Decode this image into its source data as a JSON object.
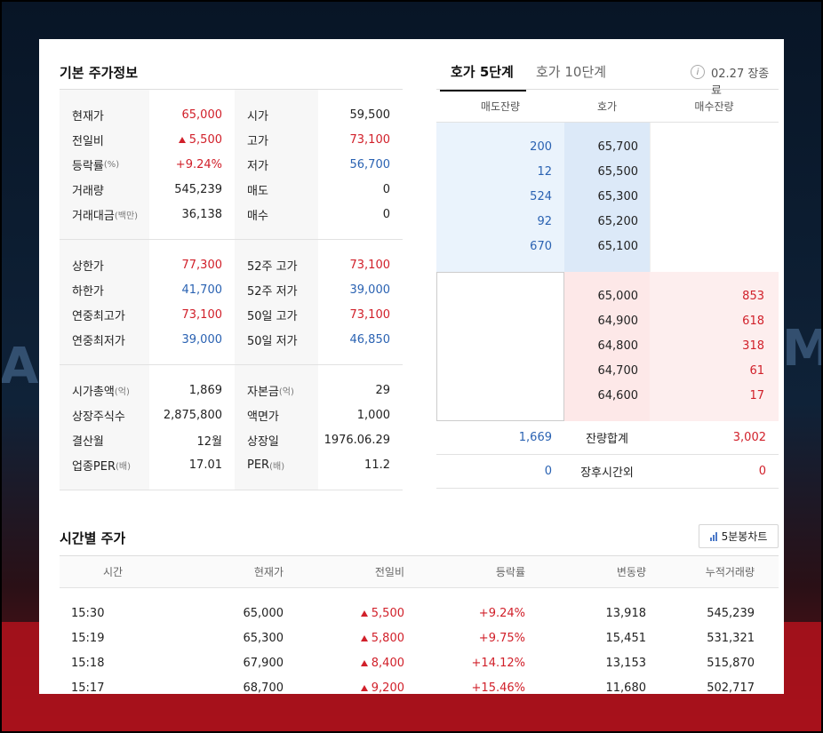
{
  "basic": {
    "title": "기본 주가정보",
    "groups": [
      {
        "rows": [
          {
            "label": "현재가",
            "label_small": "",
            "value": "65,000",
            "value_color": "red",
            "value_up": false,
            "label2": "시가",
            "label2_small": "",
            "value2": "59,500",
            "value2_color": ""
          },
          {
            "label": "전일비",
            "label_small": "",
            "value": "5,500",
            "value_color": "red",
            "value_up": true,
            "label2": "고가",
            "label2_small": "",
            "value2": "73,100",
            "value2_color": "red"
          },
          {
            "label": "등락률",
            "label_small": "(%)",
            "value": "+9.24%",
            "value_color": "red",
            "value_up": false,
            "label2": "저가",
            "label2_small": "",
            "value2": "56,700",
            "value2_color": "blue"
          },
          {
            "label": "거래량",
            "label_small": "",
            "value": "545,239",
            "value_color": "",
            "value_up": false,
            "label2": "매도",
            "label2_small": "",
            "value2": "0",
            "value2_color": ""
          },
          {
            "label": "거래대금",
            "label_small": "(백만)",
            "value": "36,138",
            "value_color": "",
            "value_up": false,
            "label2": "매수",
            "label2_small": "",
            "value2": "0",
            "value2_color": ""
          }
        ]
      },
      {
        "rows": [
          {
            "label": "상한가",
            "label_small": "",
            "value": "77,300",
            "value_color": "red",
            "value_up": false,
            "label2": "52주 고가",
            "label2_small": "",
            "value2": "73,100",
            "value2_color": "red"
          },
          {
            "label": "하한가",
            "label_small": "",
            "value": "41,700",
            "value_color": "blue",
            "value_up": false,
            "label2": "52주 저가",
            "label2_small": "",
            "value2": "39,000",
            "value2_color": "blue"
          },
          {
            "label": "연중최고가",
            "label_small": "",
            "value": "73,100",
            "value_color": "red",
            "value_up": false,
            "label2": "50일 고가",
            "label2_small": "",
            "value2": "73,100",
            "value2_color": "red"
          },
          {
            "label": "연중최저가",
            "label_small": "",
            "value": "39,000",
            "value_color": "blue",
            "value_up": false,
            "label2": "50일 저가",
            "label2_small": "",
            "value2": "46,850",
            "value2_color": "blue"
          }
        ]
      },
      {
        "rows": [
          {
            "label": "시가총액",
            "label_small": "(억)",
            "value": "1,869",
            "value_color": "",
            "value_up": false,
            "label2": "자본금",
            "label2_small": "(억)",
            "value2": "29",
            "value2_color": ""
          },
          {
            "label": "상장주식수",
            "label_small": "",
            "value": "2,875,800",
            "value_color": "",
            "value_up": false,
            "label2": "액면가",
            "label2_small": "",
            "value2": "1,000",
            "value2_color": ""
          },
          {
            "label": "결산월",
            "label_small": "",
            "value": "12월",
            "value_color": "",
            "value_up": false,
            "label2": "상장일",
            "label2_small": "",
            "value2": "1976.06.29",
            "value2_color": ""
          },
          {
            "label": "업종PER",
            "label_small": "(배)",
            "value": "17.01",
            "value_color": "",
            "value_up": false,
            "label2": "PER",
            "label2_small": "(배)",
            "value2": "11.2",
            "value2_color": ""
          }
        ]
      }
    ]
  },
  "orderbook": {
    "tab_active": "호가 5단계",
    "tab_inactive": "호가 10단계",
    "info_icon": "info-icon",
    "status": "02.27 장종료",
    "headers": [
      "매도잔량",
      "호가",
      "매수잔량"
    ],
    "asks": [
      {
        "qty": "200",
        "price": "65,700"
      },
      {
        "qty": "12",
        "price": "65,500"
      },
      {
        "qty": "524",
        "price": "65,300"
      },
      {
        "qty": "92",
        "price": "65,200"
      },
      {
        "qty": "670",
        "price": "65,100"
      }
    ],
    "bids": [
      {
        "price": "65,000",
        "qty": "853"
      },
      {
        "price": "64,900",
        "qty": "618"
      },
      {
        "price": "64,800",
        "qty": "318"
      },
      {
        "price": "64,700",
        "qty": "61"
      },
      {
        "price": "64,600",
        "qty": "17"
      }
    ],
    "total": {
      "ask": "1,669",
      "label": "잔량합계",
      "bid": "3,002"
    },
    "after": {
      "ask": "0",
      "label": "장후시간외",
      "bid": "0"
    }
  },
  "time": {
    "title": "시간별 주가",
    "chart_button": "5분봉차트",
    "headers": [
      "시간",
      "현재가",
      "전일비",
      "등락률",
      "변동량",
      "누적거래량"
    ],
    "rows": [
      {
        "time": "15:30",
        "price": "65,000",
        "change": "5,500",
        "rate": "+9.24%",
        "vol": "13,918",
        "cum": "545,239"
      },
      {
        "time": "15:19",
        "price": "65,300",
        "change": "5,800",
        "rate": "+9.75%",
        "vol": "15,451",
        "cum": "531,321"
      },
      {
        "time": "15:18",
        "price": "67,900",
        "change": "8,400",
        "rate": "+14.12%",
        "vol": "13,153",
        "cum": "515,870"
      },
      {
        "time": "15:17",
        "price": "68,700",
        "change": "9,200",
        "rate": "+15.46%",
        "vol": "11,680",
        "cum": "502,717"
      }
    ]
  },
  "colors": {
    "red": "#d1202a",
    "blue": "#2a62b2",
    "ask_bg": "#eaf3fc",
    "ask_price_bg": "#dce9f8",
    "bid_bg": "#fde8e8"
  }
}
